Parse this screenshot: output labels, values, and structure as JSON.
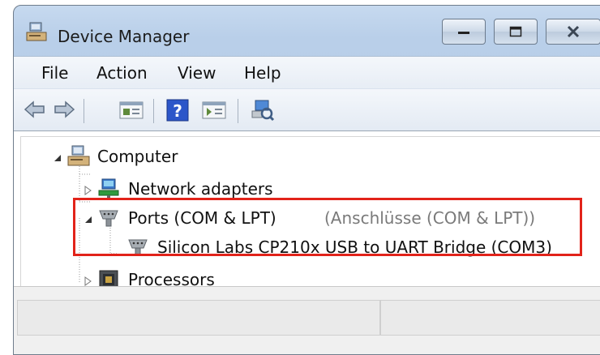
{
  "window": {
    "title": "Device Manager"
  },
  "menu": [
    "File",
    "Action",
    "View",
    "Help"
  ],
  "tree": {
    "computer": "Computer",
    "network": "Network adapters",
    "ports": "Ports (COM & LPT)",
    "ports_alt": "(Anschlüsse (COM & LPT))",
    "device": "Silicon Labs CP210x USB to UART Bridge (COM3)",
    "processors": "Processors"
  },
  "colors": {
    "highlight": "#e2231a",
    "titlebar": "#c6d9ef"
  },
  "icons": [
    "computer-icon",
    "back-icon",
    "forward-icon",
    "properties-icon",
    "help-icon",
    "update-driver-icon",
    "scan-hardware-icon",
    "network-adapter-icon",
    "port-icon",
    "processor-icon"
  ]
}
